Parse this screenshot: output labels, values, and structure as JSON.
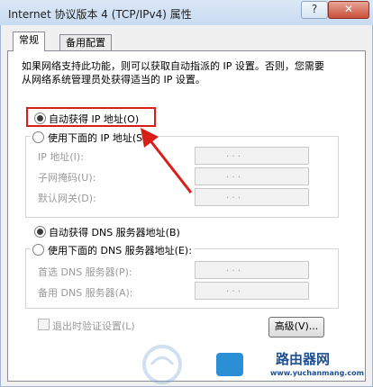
{
  "window": {
    "title": "Internet 协议版本 4 (TCP/IPv4) 属性",
    "help_icon": "?",
    "close_icon": "✕"
  },
  "tabs": [
    {
      "label": "常规",
      "active": true
    },
    {
      "label": "备用配置",
      "active": false
    }
  ],
  "description": "如果网络支持此功能，则可以获取自动指派的 IP 设置。否则，您需要从网络系统管理员处获得适当的 IP 设置。",
  "ip": {
    "auto_label": "自动获得 IP 地址(O)",
    "manual_label": "使用下面的 IP 地址(S):",
    "fields": [
      {
        "label": "IP 地址(I):",
        "value": ".  .  ."
      },
      {
        "label": "子网掩码(U):",
        "value": ".  .  ."
      },
      {
        "label": "默认网关(D):",
        "value": ".  .  ."
      }
    ]
  },
  "dns": {
    "auto_label": "自动获得 DNS 服务器地址(B)",
    "manual_label": "使用下面的 DNS 服务器地址(E):",
    "fields": [
      {
        "label": "首选 DNS 服务器(P):",
        "value": ".  .  ."
      },
      {
        "label": "备用 DNS 服务器(A):",
        "value": ".  .  ."
      }
    ]
  },
  "validate_label": "退出时验证设置(L)",
  "advanced_label": "高级(V)...",
  "watermark": {
    "text": "路由器网",
    "url": "www.yuchanmang.com"
  },
  "colors": {
    "highlight": "#d91e18",
    "titlebar": "#c7dbf1"
  }
}
